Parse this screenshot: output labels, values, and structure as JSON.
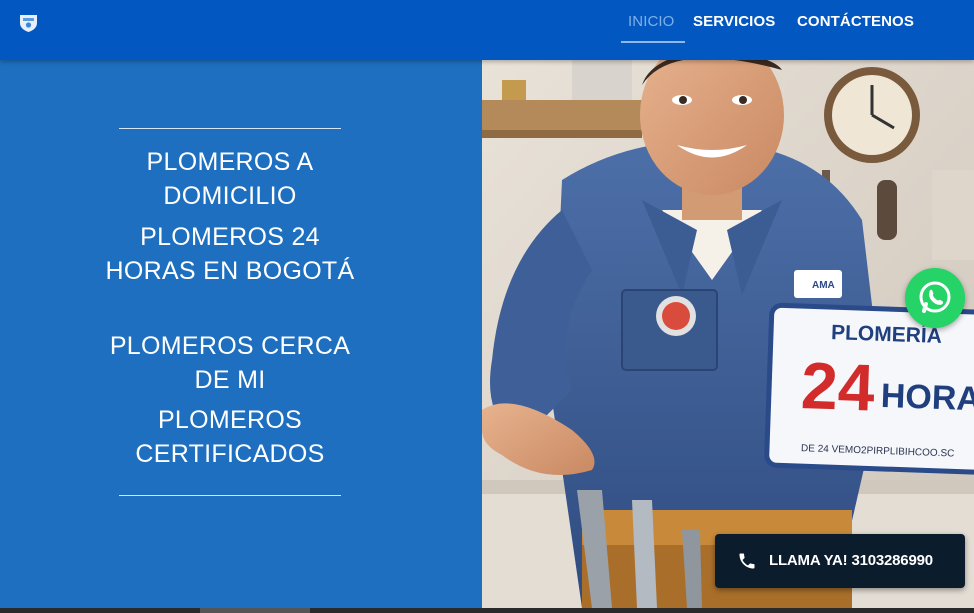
{
  "nav": {
    "logo": "shield-logo",
    "items": [
      {
        "label": "INICIO",
        "active": true
      },
      {
        "label": "SERVICIOS",
        "active": false
      },
      {
        "label": "CONTÁCTENOS",
        "active": false
      }
    ]
  },
  "hero": {
    "lines": [
      "PLOMEROS A DOMICILIO",
      "PLOMEROS 24 HORAS EN BOGOTÁ",
      "PLOMEROS CERCA DE MI",
      "PLOMEROS CERTIFICADOS"
    ],
    "image": {
      "sign_title": "PLOMERÍA",
      "sign_number": "24",
      "sign_unit": "HORAS",
      "sign_footer": "DE 24 VEMO2PIRPLIBIHCOO.SC",
      "badge_text": "AMA"
    }
  },
  "floating": {
    "whatsapp_icon": "whatsapp-icon",
    "call_label": "LLAMA YA! 3103286990",
    "call_icon": "phone-icon"
  },
  "colors": {
    "navbar": "#0357c0",
    "hero_left": "#1e6fbf",
    "whatsapp": "#25d366",
    "call_button": "#0b1c2c"
  }
}
